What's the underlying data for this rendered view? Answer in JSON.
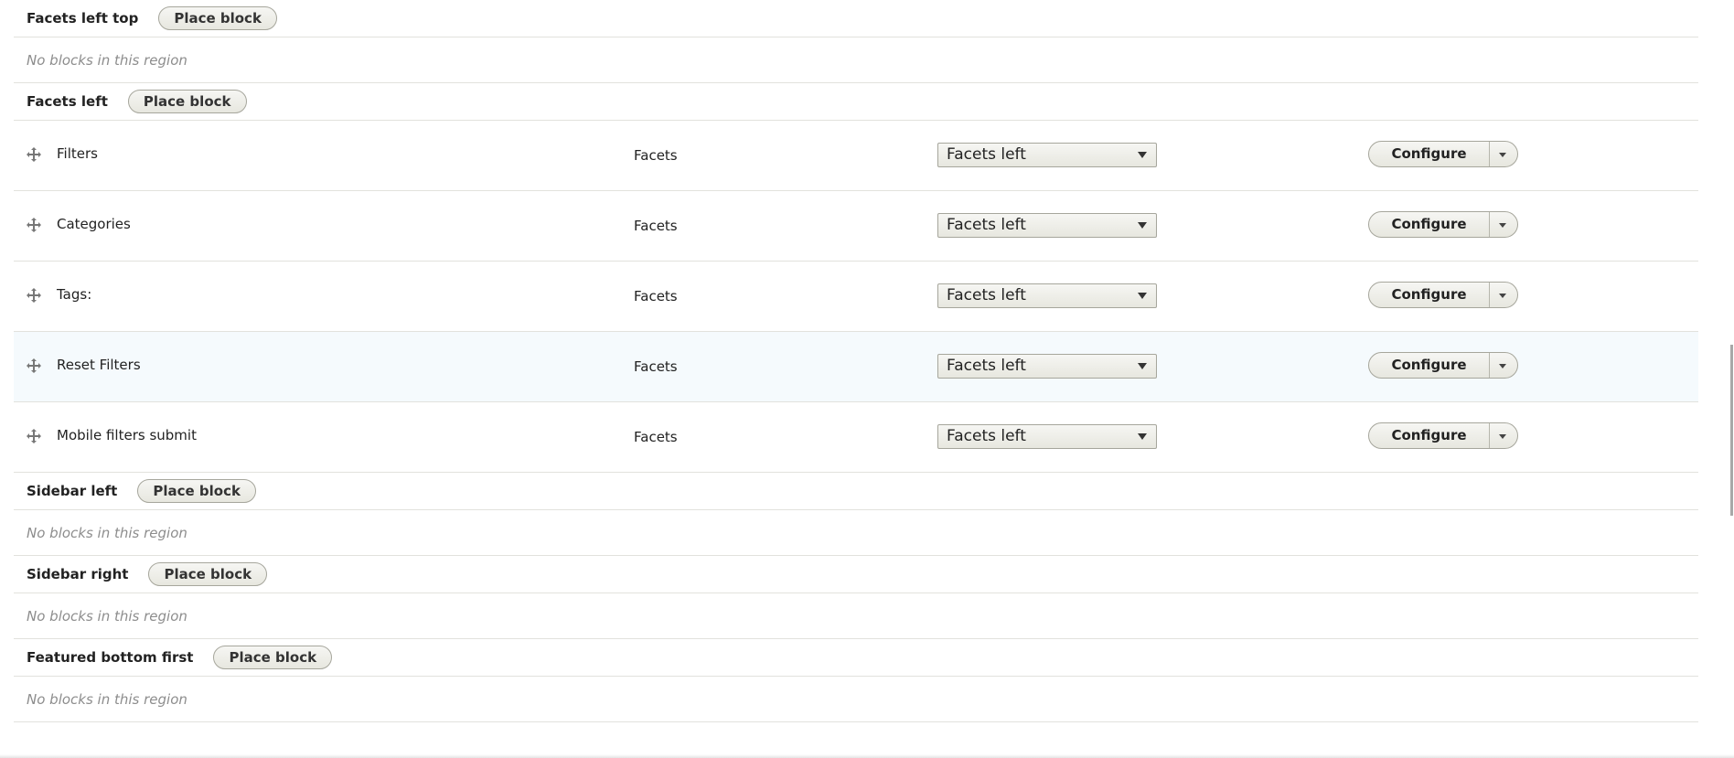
{
  "common": {
    "place_block": "Place block",
    "no_blocks": "No blocks in this region",
    "configure": "Configure"
  },
  "regions": {
    "facets_left_top": "Facets left top",
    "facets_left": "Facets left",
    "sidebar_left": "Sidebar left",
    "sidebar_right": "Sidebar right",
    "featured_bottom_first": "Featured bottom first"
  },
  "blocks": [
    {
      "name": "Filters",
      "category": "Facets",
      "region": "Facets left"
    },
    {
      "name": "Categories",
      "category": "Facets",
      "region": "Facets left"
    },
    {
      "name": "Tags:",
      "category": "Facets",
      "region": "Facets left"
    },
    {
      "name": "Reset Filters",
      "category": "Facets",
      "region": "Facets left"
    },
    {
      "name": "Mobile filters submit",
      "category": "Facets",
      "region": "Facets left"
    }
  ]
}
